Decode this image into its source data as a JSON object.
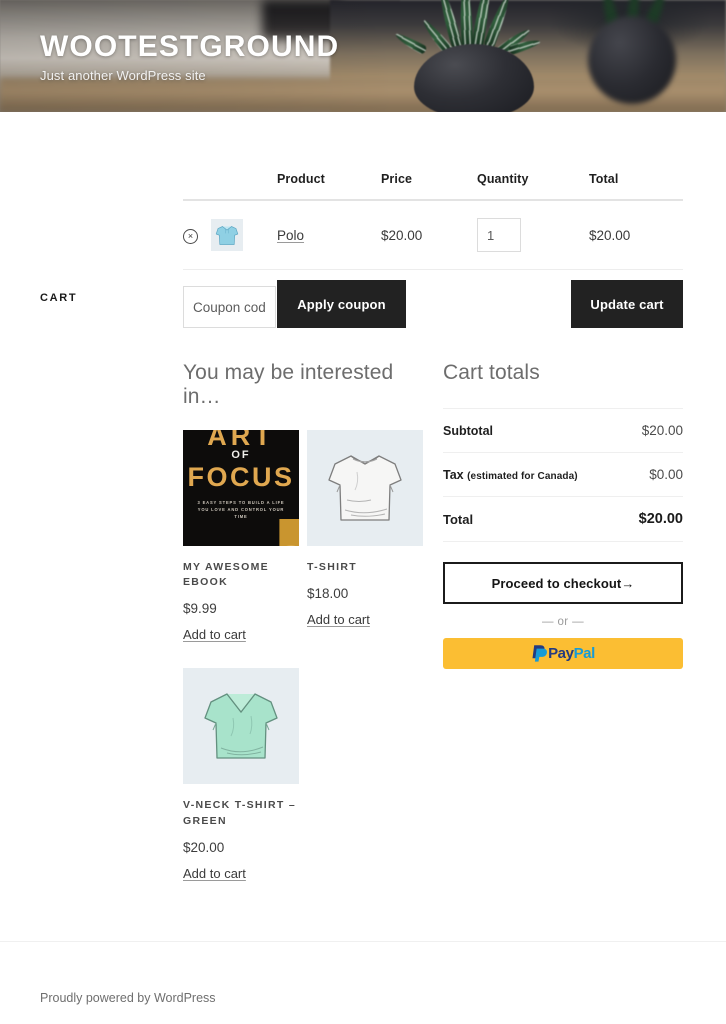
{
  "header": {
    "site_title": "WOOTESTGROUND",
    "site_description": "Just another WordPress site",
    "hero_image_alt": "succulent-plant-in-dark-pot"
  },
  "page": {
    "title": "CART"
  },
  "cart_table": {
    "columns": [
      "Product",
      "Price",
      "Quantity",
      "Total"
    ],
    "rows": [
      {
        "remove_icon": "remove-circle-x-icon",
        "remove_label": "×",
        "thumbnail": "polo-shirt-thumbnail",
        "product": "Polo",
        "price": "$20.00",
        "quantity": "1",
        "total": "$20.00"
      }
    ]
  },
  "cart_actions": {
    "coupon_placeholder": "Coupon code",
    "coupon_value": "",
    "apply_coupon_label": "Apply coupon",
    "update_cart_label": "Update cart"
  },
  "upsells": {
    "heading": "You may be interested in…",
    "products": [
      {
        "image": "art-of-focus-ebook-cover",
        "cover": {
          "line1": "ART",
          "line2": "OF",
          "line3": "FOCUS",
          "tagline": "3 EASY STEPS TO BUILD A LIFE YOU LOVE AND CONTROL YOUR TIME",
          "icon": "wristwatch-icon"
        },
        "title": "MY AWESOME EBOOK",
        "price": "$9.99",
        "add_label": "Add to cart"
      },
      {
        "image": "white-tshirt-sketch",
        "title": "T-SHIRT",
        "price": "$18.00",
        "add_label": "Add to cart"
      },
      {
        "image": "green-vneck-tshirt-sketch",
        "title": "V-NECK T-SHIRT – GREEN",
        "price": "$20.00",
        "add_label": "Add to cart"
      }
    ]
  },
  "cart_totals": {
    "heading": "Cart totals",
    "rows": [
      {
        "label": "Subtotal",
        "note": "",
        "value": "$20.00"
      },
      {
        "label": "Tax",
        "note": "(estimated for Canada)",
        "value": "$0.00"
      },
      {
        "label": "Total",
        "note": "",
        "value": "$20.00"
      }
    ],
    "checkout_label": "Proceed to checkout→",
    "or_label": "— or —",
    "paypal": {
      "icon": "paypal-icon",
      "text_a": "Pay",
      "text_b": "Pal"
    }
  },
  "footer": {
    "credit": "Proudly powered by WordPress"
  },
  "colors": {
    "button_dark": "#222222",
    "paypal_yellow": "#fbbe33",
    "paypal_blue_dark": "#243b80",
    "paypal_blue_light": "#169bd7",
    "book_gold": "#e0a850",
    "thumb_bg": "#e7edf1"
  }
}
